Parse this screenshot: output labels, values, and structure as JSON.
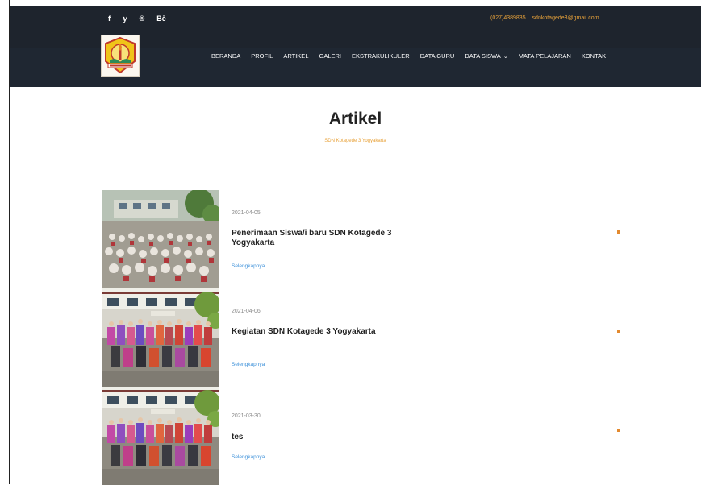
{
  "topbar": {
    "social": [
      "f",
      "𝕪",
      "®",
      "Bē"
    ],
    "phone": "(027)4389835",
    "email": "sdnkotagede3@gmail.com"
  },
  "nav": {
    "items": [
      "BERANDA",
      "PROFIL",
      "ARTIKEL",
      "GALERI",
      "EKSTRAKULIKULER",
      "DATA GURU",
      "DATA SISWA",
      "MATA PELAJARAN",
      "KONTAK"
    ],
    "dropdown_item_index": 6
  },
  "page": {
    "title": "Artikel",
    "subtitle": "SDN Kotagede 3 Yogyakarta"
  },
  "articles": [
    {
      "date": "2021-04-05",
      "title": "Penerimaan Siswa/i baru SDN Kotagede 3 Yogyakarta",
      "link": "Selengkapnya"
    },
    {
      "date": "2021-04-06",
      "title": "Kegiatan SDN Kotagede 3 Yogyakarta",
      "link": "Selengkapnya"
    },
    {
      "date": "2021-03-30",
      "title": "tes",
      "link": "Selengkapnya"
    }
  ],
  "colors": {
    "accent": "#e8a23a",
    "link": "#3a8fd9",
    "marker": "#e38a2f",
    "topbar": "#1e242d",
    "navbar": "#1f2732"
  }
}
